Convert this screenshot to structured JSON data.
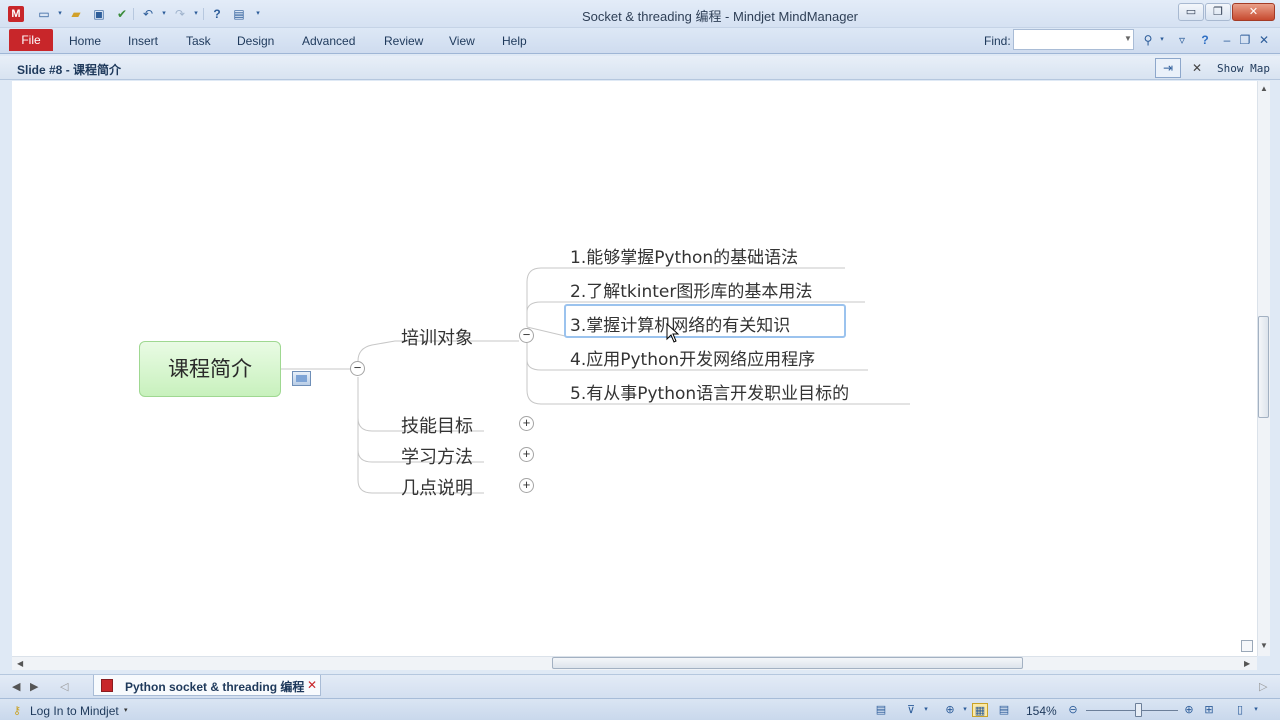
{
  "window": {
    "title": "Socket & threading 编程 - Mindjet MindManager",
    "controls": {
      "minimize": "▭",
      "maximize": "❐",
      "close": "✕"
    }
  },
  "app_logo": "M",
  "quick_access": {
    "icons": [
      "new-document-icon",
      "open-folder-icon",
      "save-icon",
      "check-icon",
      "undo-icon",
      "redo-icon",
      "help-icon",
      "slideshow-icon"
    ]
  },
  "ribbon": {
    "file_tab": "File",
    "tabs": [
      "Home",
      "Insert",
      "Task",
      "Design",
      "Advanced",
      "Review",
      "View",
      "Help"
    ],
    "find_label": "Find:",
    "find_value": ""
  },
  "slide_bar": {
    "label": "Slide #8 - 课程简介",
    "show_map": "Show Map"
  },
  "mindmap": {
    "central_topic": "课程简介",
    "main_topics": [
      {
        "label": "培训对象",
        "expanded": true
      },
      {
        "label": "技能目标",
        "expanded": false
      },
      {
        "label": "学习方法",
        "expanded": false
      },
      {
        "label": "几点说明",
        "expanded": false
      }
    ],
    "subtopics": [
      "1.能够掌握Python的基础语法",
      "2.了解tkinter图形库的基本用法",
      "3.掌握计算机网络的有关知识",
      "4.应用Python开发网络应用程序",
      "5.有从事Python语言开发职业目标的"
    ],
    "selected_subtopic_index": 2,
    "toggle_collapse": "−",
    "toggle_expand": "+"
  },
  "tab_bar": {
    "doc_tab": "Python socket & threading 编程"
  },
  "status_bar": {
    "login": "Log In to Mindjet",
    "zoom": "154%"
  },
  "colors": {
    "file_tab": "#c8262a",
    "central_topic_fill": "#c8f1bd",
    "selection": "#9bc3ee",
    "chrome": "#dfe9f5"
  }
}
